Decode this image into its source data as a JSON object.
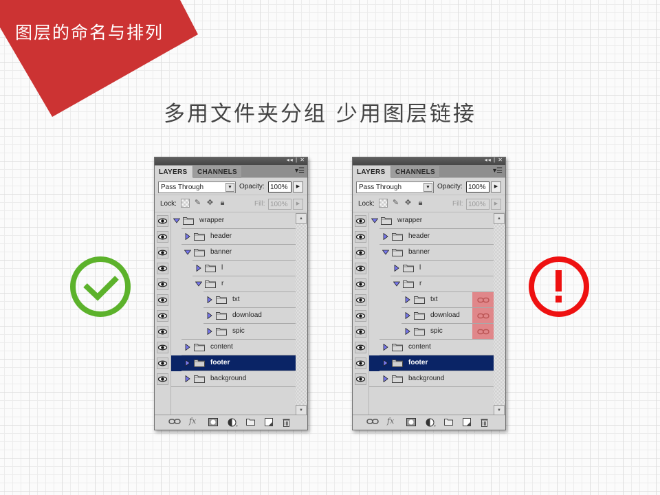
{
  "corner": {
    "title": "图层的命名与排列",
    "color": "#cc3333"
  },
  "subtitle": "多用文件夹分组  少用图层链接",
  "good_icon": {
    "name": "check-circle",
    "color": "#5cb22b"
  },
  "bad_icon": {
    "name": "exclamation-circle",
    "color": "#ee1111"
  },
  "panels": [
    {
      "id": "good",
      "tabs": {
        "layers": "LAYERS",
        "channels": "CHANNELS"
      },
      "blend_mode": "Pass Through",
      "opacity_label": "Opacity:",
      "opacity": "100%",
      "lock_label": "Lock:",
      "fill_label": "Fill:",
      "fill": "100%",
      "layers": [
        {
          "name": "wrapper",
          "depth": 0,
          "expanded": true,
          "linked": false,
          "selected": false
        },
        {
          "name": "header",
          "depth": 1,
          "expanded": false,
          "linked": false,
          "selected": false
        },
        {
          "name": "banner",
          "depth": 1,
          "expanded": true,
          "linked": false,
          "selected": false
        },
        {
          "name": "l",
          "depth": 2,
          "expanded": false,
          "linked": false,
          "selected": false
        },
        {
          "name": "r",
          "depth": 2,
          "expanded": true,
          "linked": false,
          "selected": false
        },
        {
          "name": "txt",
          "depth": 3,
          "expanded": false,
          "linked": false,
          "selected": false
        },
        {
          "name": "download",
          "depth": 3,
          "expanded": false,
          "linked": false,
          "selected": false
        },
        {
          "name": "spic",
          "depth": 3,
          "expanded": false,
          "linked": false,
          "selected": false
        },
        {
          "name": "content",
          "depth": 1,
          "expanded": false,
          "linked": false,
          "selected": false
        },
        {
          "name": "footer",
          "depth": 1,
          "expanded": false,
          "linked": false,
          "selected": true
        },
        {
          "name": "background",
          "depth": 1,
          "expanded": false,
          "linked": false,
          "selected": false
        }
      ]
    },
    {
      "id": "bad",
      "tabs": {
        "layers": "LAYERS",
        "channels": "CHANNELS"
      },
      "blend_mode": "Pass Through",
      "opacity_label": "Opacity:",
      "opacity": "100%",
      "lock_label": "Lock:",
      "fill_label": "Fill:",
      "fill": "100%",
      "layers": [
        {
          "name": "wrapper",
          "depth": 0,
          "expanded": true,
          "linked": false,
          "selected": false
        },
        {
          "name": "header",
          "depth": 1,
          "expanded": false,
          "linked": false,
          "selected": false
        },
        {
          "name": "banner",
          "depth": 1,
          "expanded": true,
          "linked": false,
          "selected": false
        },
        {
          "name": "l",
          "depth": 2,
          "expanded": false,
          "linked": false,
          "selected": false
        },
        {
          "name": "r",
          "depth": 2,
          "expanded": true,
          "linked": false,
          "selected": false
        },
        {
          "name": "txt",
          "depth": 3,
          "expanded": false,
          "linked": true,
          "selected": false
        },
        {
          "name": "download",
          "depth": 3,
          "expanded": false,
          "linked": true,
          "selected": false
        },
        {
          "name": "spic",
          "depth": 3,
          "expanded": false,
          "linked": true,
          "selected": false
        },
        {
          "name": "content",
          "depth": 1,
          "expanded": false,
          "linked": false,
          "selected": false
        },
        {
          "name": "footer",
          "depth": 1,
          "expanded": false,
          "linked": false,
          "selected": true
        },
        {
          "name": "background",
          "depth": 1,
          "expanded": false,
          "linked": false,
          "selected": false
        }
      ]
    }
  ],
  "bottom_icons": [
    "link-layers-icon",
    "fx-icon",
    "mask-icon",
    "adjustment-icon",
    "new-group-icon",
    "new-layer-icon",
    "trash-icon"
  ],
  "bottom_glyphs": {
    "fx": "fx"
  }
}
